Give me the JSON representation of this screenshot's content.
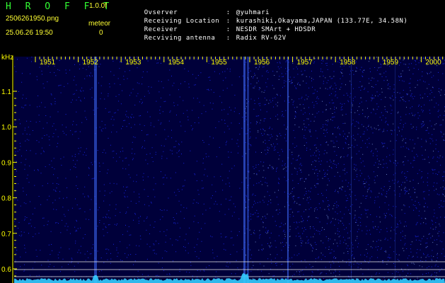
{
  "header": {
    "brand": "H R O F F T",
    "version": "1.0.0f",
    "filename": "2506261950.png",
    "datetime": "25.06.26 19:50",
    "meteor_label": "meteor",
    "meteor_count": "0"
  },
  "info": [
    {
      "key": "Ovserver",
      "sep": ":",
      "value": "@yuhmari"
    },
    {
      "key": "Receiving Location",
      "sep": ":",
      "value": "kurashiki,Okayama,JAPAN (133.77E, 34.58N)"
    },
    {
      "key": "Receiver",
      "sep": ":",
      "value": "NESDR SMArt + HDSDR"
    },
    {
      "key": "Recviving antenna",
      "sep": ":",
      "value": "Radix RV-62V"
    }
  ],
  "spectrogram": {
    "unit_label": "kHz",
    "time_ticks": [
      "1951",
      "1952",
      "1953",
      "1954",
      "1955",
      "1956",
      "1957",
      "1958",
      "1959",
      "2000"
    ],
    "freq_ticks": [
      "1.1",
      "1.0",
      "0.9",
      "0.8",
      "0.7",
      "0.6"
    ],
    "colors": {
      "background": "#00003a",
      "noise": "#1c2cff",
      "grid": "#ffff00",
      "trace": "#33ccff"
    }
  }
}
